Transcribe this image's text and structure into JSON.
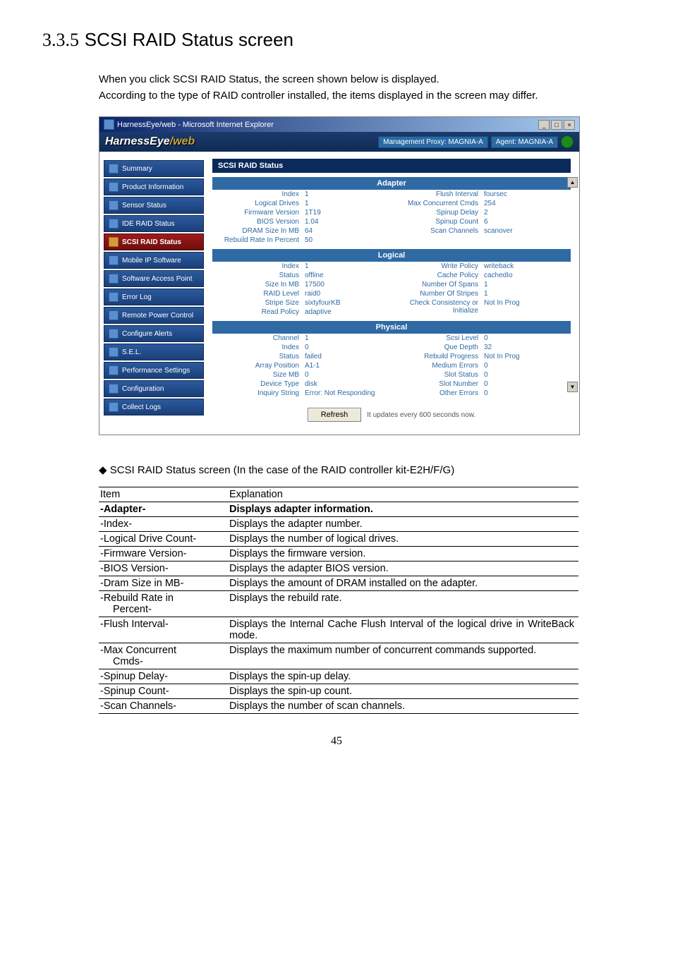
{
  "page": {
    "section_number": "3.3.5",
    "section_title": "SCSI RAID Status screen",
    "intro1": "When you click SCSI RAID Status, the screen shown below is displayed.",
    "intro2": "According to the type of RAID controller installed, the items displayed in the screen may differ.",
    "page_number": "45"
  },
  "window": {
    "titlebar": "HarnessEye/web - Microsoft Internet Explorer",
    "logo_left": "HarnessEye",
    "logo_right": "/web",
    "mgmt_proxy": "Management Proxy: MAGNIA-A",
    "agent": "Agent: MAGNIA-A",
    "panel_title": "SCSI RAID Status",
    "refresh": "Refresh",
    "update_text": "It updates every 600 seconds now."
  },
  "nav": {
    "items": [
      "Summary",
      "Product Information",
      "Sensor Status",
      "IDE RAID Status",
      "SCSI RAID Status",
      "Mobile IP Software",
      "Software Access Point",
      "Error Log",
      "Remote Power Control",
      "Configure Alerts",
      "S.E.L.",
      "Performance Settings",
      "Configuration",
      "Collect Logs"
    ]
  },
  "sections": {
    "adapter": {
      "title": "Adapter",
      "left": [
        {
          "k": "Index",
          "v": "1"
        },
        {
          "k": "Logical Drives",
          "v": "1"
        },
        {
          "k": "Firmware Version",
          "v": "1T19"
        },
        {
          "k": "BIOS Version",
          "v": "1.04"
        },
        {
          "k": "DRAM Size In MB",
          "v": "64"
        },
        {
          "k": "Rebuild Rate In Percent",
          "v": "50"
        }
      ],
      "right": [
        {
          "k": "Flush Interval",
          "v": "foursec"
        },
        {
          "k": "Max Concurrent Cmds",
          "v": "254"
        },
        {
          "k": "Spinup Delay",
          "v": "2"
        },
        {
          "k": "Spinup Count",
          "v": "6"
        },
        {
          "k": "Scan Channels",
          "v": "scanover"
        }
      ]
    },
    "logical": {
      "title": "Logical",
      "left": [
        {
          "k": "Index",
          "v": "1"
        },
        {
          "k": "Status",
          "v": "offline"
        },
        {
          "k": "Size In MB",
          "v": "17500"
        },
        {
          "k": "RAID Level",
          "v": "raid0"
        },
        {
          "k": "Stripe Size",
          "v": "sixtyfourKB"
        },
        {
          "k": "Read Policy",
          "v": "adaptive"
        }
      ],
      "right": [
        {
          "k": "Write Policy",
          "v": "writeback"
        },
        {
          "k": "Cache Policy",
          "v": "cachedIo"
        },
        {
          "k": "Number Of Spans",
          "v": "1"
        },
        {
          "k": "Number Of Stripes",
          "v": "1"
        },
        {
          "k": "Check Consistency or Initialize",
          "v": "Not In Prog"
        }
      ]
    },
    "physical": {
      "title": "Physical",
      "left": [
        {
          "k": "Channel",
          "v": "1"
        },
        {
          "k": "Index",
          "v": "0"
        },
        {
          "k": "Status",
          "v": "failed"
        },
        {
          "k": "Array Position",
          "v": "A1-1"
        },
        {
          "k": "Size MB",
          "v": "0"
        },
        {
          "k": "Device Type",
          "v": "disk"
        },
        {
          "k": "Inquiry String",
          "v": "Error: Not Responding"
        }
      ],
      "right": [
        {
          "k": "Scsi Level",
          "v": "0"
        },
        {
          "k": "Que Depth",
          "v": "32"
        },
        {
          "k": "Rebuild Progress",
          "v": "Not In Prog"
        },
        {
          "k": "Medium Errors",
          "v": "0"
        },
        {
          "k": "Slot Status",
          "v": "0"
        },
        {
          "k": "Slot Number",
          "v": "0"
        },
        {
          "k": "Other Errors",
          "v": "0"
        }
      ]
    }
  },
  "caption": "SCSI RAID Status screen (In the case of the RAID controller kit-E2H/F/G)",
  "table": {
    "head": {
      "c1": "Item",
      "c2": "Explanation"
    },
    "rows": [
      {
        "bold": true,
        "c1": "-Adapter-",
        "c2": "Displays adapter information."
      },
      {
        "c1": "-Index-",
        "c2": "Displays the adapter number."
      },
      {
        "c1": "-Logical Drive Count-",
        "c2": "Displays the number of logical drives."
      },
      {
        "c1": "-Firmware Version-",
        "c2": "Displays the firmware version."
      },
      {
        "c1": "-BIOS Version-",
        "c2": "Displays the adapter BIOS version."
      },
      {
        "c1": "-Dram Size in MB-",
        "c2": "Displays the amount of DRAM installed on the adapter."
      },
      {
        "c1": "-Rebuild Rate in",
        "c1b": "Percent-",
        "c2": "Displays the rebuild rate."
      },
      {
        "c1": "-Flush Interval-",
        "c2": "Displays the Internal Cache Flush Interval of the logical drive in WriteBack mode.",
        "justify": true
      },
      {
        "c1": "-Max Concurrent",
        "c1b": "Cmds-",
        "c2": "Displays the maximum number of concurrent commands supported."
      },
      {
        "c1": "-Spinup Delay-",
        "c2": "Displays the spin-up delay."
      },
      {
        "c1": "-Spinup Count-",
        "c2": "Displays the spin-up count."
      },
      {
        "c1": "-Scan Channels-",
        "c2": "Displays the number of scan channels."
      }
    ]
  }
}
